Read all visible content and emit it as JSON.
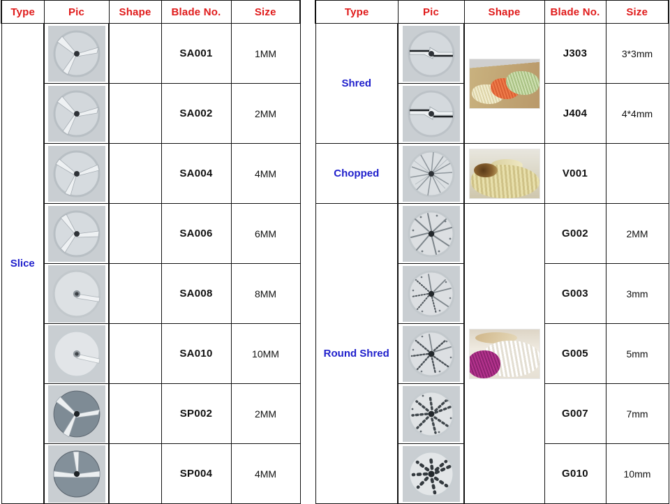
{
  "tables": [
    {
      "id": "left-table",
      "headers": [
        "Type",
        "Pic",
        "Shape",
        "Blade No.",
        "Size"
      ],
      "groups": [
        {
          "type": "Slice",
          "rows": [
            {
              "blade": "SA001",
              "size": "1MM",
              "disc": "slice-3slot-light"
            },
            {
              "blade": "SA002",
              "size": "2MM",
              "disc": "slice-3slot-light"
            },
            {
              "blade": "SA004",
              "size": "4MM",
              "disc": "slice-3slot-light"
            },
            {
              "blade": "SA006",
              "size": "6MM",
              "disc": "slice-3slot-light"
            },
            {
              "blade": "SA008",
              "size": "8MM",
              "disc": "slice-1slot-light"
            },
            {
              "blade": "SA010",
              "size": "10MM",
              "disc": "slice-1slot-light"
            },
            {
              "blade": "SP002",
              "size": "2MM",
              "disc": "slice-3slot-dark"
            },
            {
              "blade": "SP004",
              "size": "4MM",
              "disc": "slice-1slot-dark"
            }
          ]
        }
      ]
    },
    {
      "id": "right-table",
      "headers": [
        "Type",
        "Pic",
        "Shape",
        "Blade No.",
        "Size"
      ],
      "groups": [
        {
          "type": "Shred",
          "shape_photo": "shred-vegetables-photo",
          "rows": [
            {
              "blade": "J303",
              "size": "3*3mm",
              "disc": "shred-cross-light"
            },
            {
              "blade": "J404",
              "size": "4*4mm",
              "disc": "shred-cross-light"
            }
          ]
        },
        {
          "type": "Chopped",
          "shape_photo": "chopped-vegetables-photo",
          "rows": [
            {
              "blade": "V001",
              "size": "",
              "disc": "chopped-radial-light"
            }
          ]
        },
        {
          "type": "Round Shred",
          "shape_photo": "round-shred-vegetables-photo",
          "rows": [
            {
              "blade": "G002",
              "size": "2MM",
              "disc": "round-shred-8blade"
            },
            {
              "blade": "G003",
              "size": "3mm",
              "disc": "round-shred-fine"
            },
            {
              "blade": "G005",
              "size": "5mm",
              "disc": "round-shred-medium"
            },
            {
              "blade": "G007",
              "size": "7mm",
              "disc": "round-shred-coarse"
            },
            {
              "blade": "G010",
              "size": "10mm",
              "disc": "round-shred-extra-coarse"
            }
          ]
        }
      ]
    }
  ],
  "colors": {
    "header_text": "#e01b1b",
    "type_text": "#2020cc",
    "grid_line": "#111111",
    "cell_text": "#111111",
    "disc_background": "#c9ced2"
  }
}
